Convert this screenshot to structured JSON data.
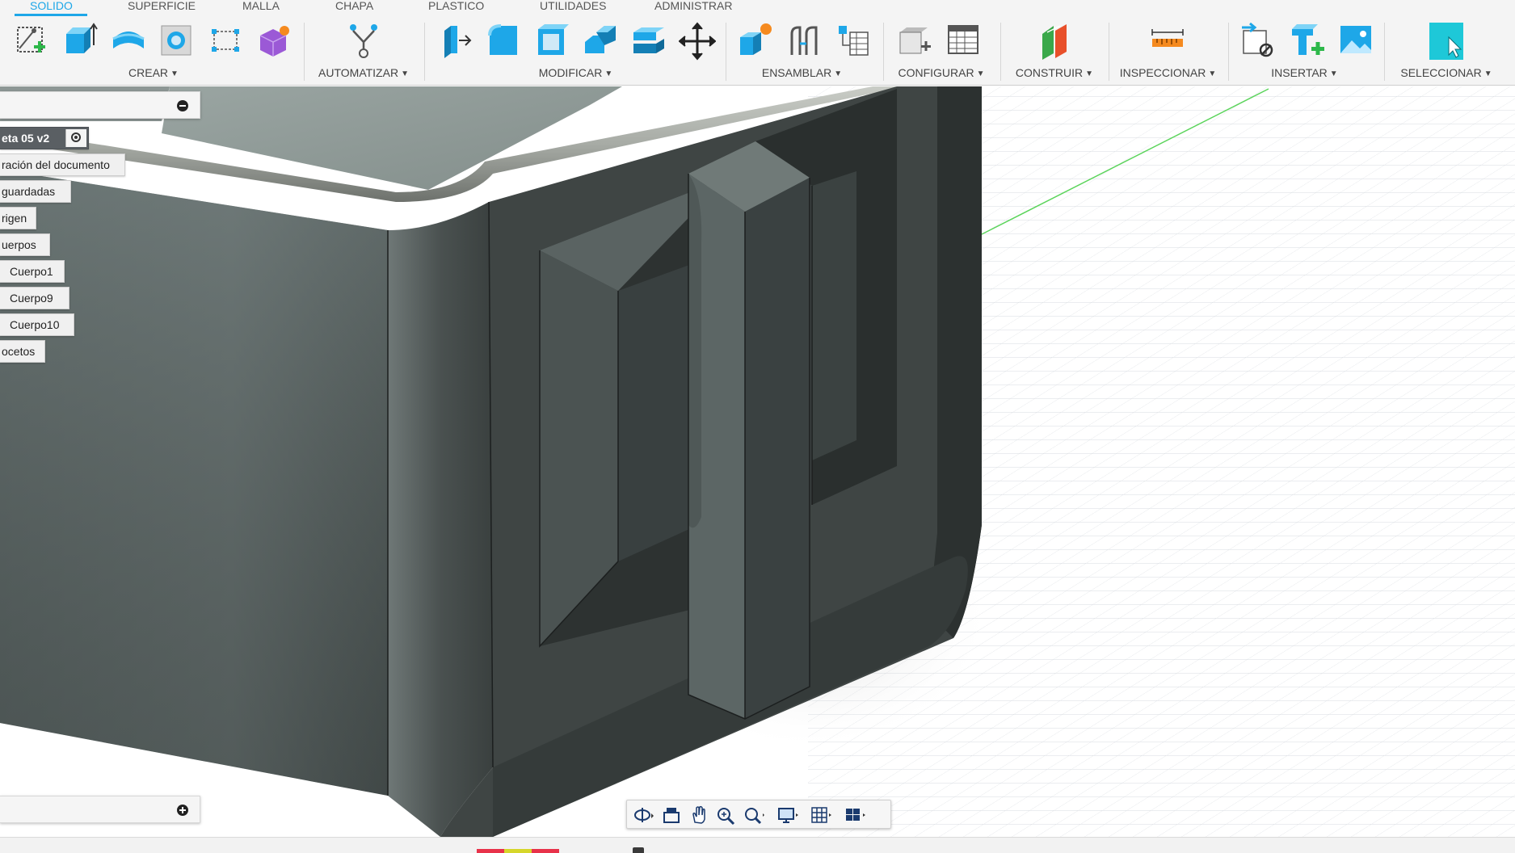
{
  "tabs": [
    {
      "label": "SOLIDO",
      "active": true
    },
    {
      "label": "SUPERFICIE",
      "active": false
    },
    {
      "label": "MALLA",
      "active": false
    },
    {
      "label": "CHAPA",
      "active": false
    },
    {
      "label": "PLASTICO",
      "active": false
    },
    {
      "label": "UTILIDADES",
      "active": false
    },
    {
      "label": "ADMINISTRAR",
      "active": false
    }
  ],
  "toolbar": {
    "groups": [
      {
        "label": "CREAR",
        "icons": [
          "create-sketch-icon",
          "extrude-icon",
          "revolve-icon",
          "hole-icon",
          "pattern-icon",
          "form-icon"
        ]
      },
      {
        "label": "AUTOMATIZAR",
        "icons": [
          "automate-icon"
        ]
      },
      {
        "label": "MODIFICAR",
        "icons": [
          "press-pull-icon",
          "fillet-icon",
          "shell-icon",
          "combine-icon",
          "offset-face-icon",
          "move-icon"
        ]
      },
      {
        "label": "ENSAMBLAR",
        "icons": [
          "new-component-icon",
          "joint-icon",
          "table-icon"
        ]
      },
      {
        "label": "CONFIGURAR",
        "icons": [
          "configure-icon",
          "config-table-icon"
        ]
      },
      {
        "label": "CONSTRUIR",
        "icons": [
          "construct-plane-icon"
        ]
      },
      {
        "label": "INSPECCIONAR",
        "icons": [
          "measure-icon"
        ]
      },
      {
        "label": "INSERTAR",
        "icons": [
          "insert-derive-icon",
          "insert-mesh-icon",
          "insert-canvas-icon"
        ]
      },
      {
        "label": "SELECCIONAR",
        "icons": [
          "select-icon"
        ]
      }
    ],
    "accent": "#1ea7e8"
  },
  "browser": {
    "root": "eta 05 v2",
    "items": [
      {
        "label": "ración del documento",
        "child": false
      },
      {
        "label": "guardadas",
        "child": false
      },
      {
        "label": "rigen",
        "child": false
      },
      {
        "label": "uerpos",
        "child": false
      },
      {
        "label": "Cuerpo1",
        "child": true
      },
      {
        "label": "Cuerpo9",
        "child": true
      },
      {
        "label": "Cuerpo10",
        "child": true
      },
      {
        "label": "ocetos",
        "child": false
      }
    ]
  },
  "navbar": {
    "items": [
      "orbit-icon",
      "look-at-icon",
      "pan-icon",
      "zoom-icon",
      "fit-icon",
      "display-settings-icon",
      "grid-settings-icon",
      "viewports-icon"
    ]
  },
  "timeline": {
    "colors": [
      "#e8324a",
      "#d6d62a",
      "#e8324a"
    ]
  }
}
